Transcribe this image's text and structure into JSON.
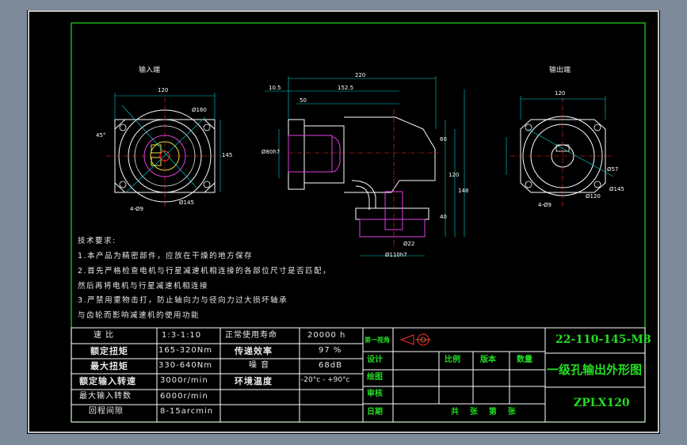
{
  "views": {
    "left_title": "输入端",
    "right_title": "输出端"
  },
  "dims": {
    "left_width": "120",
    "left_pcd": "Ø160",
    "left_side": "145",
    "left_angle": "45°",
    "left_holes": "4-Ø9",
    "left_outer": "Ø145",
    "center_total": "220",
    "center_a": "10.5",
    "center_b": "152.5",
    "center_c": "50",
    "center_h1": "60",
    "center_h2": "120",
    "center_h3": "148",
    "center_h4": "40",
    "center_d1": "Ø80h7",
    "center_d2": "Ø110h7",
    "center_d3": "Ø22",
    "right_width": "120",
    "right_d1": "Ø57",
    "right_d2": "Ø145",
    "right_d3": "Ø120",
    "right_holes": "4-Ø9"
  },
  "notes": {
    "title": "技术要求:",
    "lines": [
      "1.本产品为精密部件，应放在干燥的地方保存",
      "2.首先严格检查电机与行星减速机相连接的各部位尺寸是否匹配，",
      "然后再将电机与行星减速机相连接",
      "3.严禁用重物击打，防止轴向力与径向力过大损坏轴承",
      "与齿轮而影响减速机的使用功能"
    ]
  },
  "spec_table": {
    "rows": [
      [
        "速 比",
        "1:3-1:10",
        "正常使用寿命",
        "20000 h"
      ],
      [
        "额定扭矩",
        "165-320Nm",
        "传递效率",
        "97 %"
      ],
      [
        "最大扭矩",
        "330-640Nm",
        "噪 音",
        "68dB"
      ],
      [
        "额定输入转速",
        "3000r/min",
        "环境温度",
        "-20°c - +90°c"
      ],
      [
        "最大输入转数",
        "6000r/min",
        "",
        ""
      ],
      [
        "回程间隙",
        "8-15arcmin",
        "",
        ""
      ]
    ]
  },
  "title_block": {
    "projection": "第一视角",
    "design": "设计",
    "scale": "比例",
    "version": "版本",
    "quantity": "数量",
    "draw": "绘图",
    "review": "审核",
    "date": "日期",
    "sheets": "共    张    第    张",
    "part_number": "22-110-145-M8",
    "drawing_name": "一级孔输出外形图",
    "model": "ZPLX120"
  },
  "colors": {
    "background": "#7c8a99",
    "sheet": "#000000",
    "frame_line": "#ffffff",
    "title_text": "#22dd22",
    "body_text": "#e8e8e8",
    "cyan_line": "#00d0d0",
    "red_line": "#ff3333",
    "magenta_line": "#e040e0",
    "yellow_line": "#e8e040"
  },
  "icons": {
    "projection_symbol": "first-angle-projection-icon"
  }
}
